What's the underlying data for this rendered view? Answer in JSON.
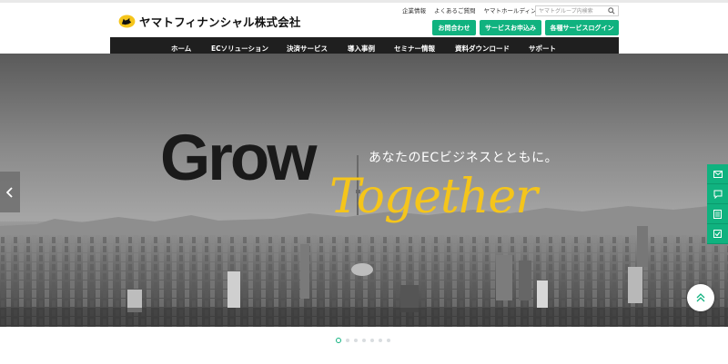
{
  "brand": {
    "name": "ヤマトフィナンシャル株式会社"
  },
  "header": {
    "util_links": [
      "企業情報",
      "よくあるご質問",
      "ヤマトホールディングス"
    ],
    "search": {
      "placeholder": "ヤマトグループ内検索",
      "value": ""
    },
    "buttons": {
      "contact": "お問合わせ",
      "apply": "サービスお申込み",
      "login": "各種サービスログイン"
    }
  },
  "nav": {
    "items": [
      "ホーム",
      "ECソリューション",
      "決済サービス",
      "導入事例",
      "セミナー情報",
      "資料ダウンロード",
      "サポート"
    ]
  },
  "hero": {
    "headline": "Grow",
    "tagline": "あなたのECビジネスとともに。",
    "script": "Together"
  },
  "carousel": {
    "slide_count": 7,
    "active_index": 0
  },
  "icons": {
    "logo": "black-cat-logo-icon",
    "search": "search-icon",
    "prev": "chevron-left-icon",
    "side": [
      "mail-icon",
      "chat-icon",
      "document-icon",
      "checklist-icon"
    ],
    "totop": "chevron-up-icon"
  },
  "colors": {
    "accent": "#10b27f",
    "nav_bg": "#1f1f1f",
    "together": "#f5c51b"
  }
}
